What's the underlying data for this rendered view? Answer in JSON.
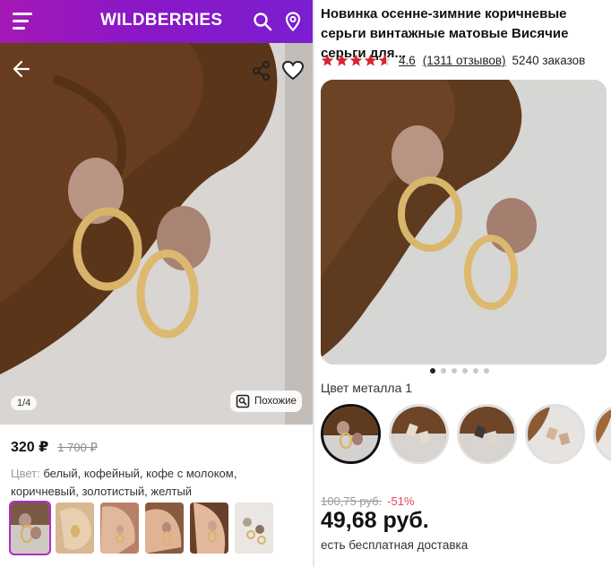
{
  "left": {
    "brand": "WILDBERRIES",
    "header_icons": [
      "menu-icon",
      "search-icon",
      "location-pin-icon"
    ],
    "overlay_icons": [
      "back-arrow-icon",
      "share-icon",
      "heart-icon"
    ],
    "image_counter": "1/4",
    "similar_label": "Похожие",
    "price": "320 ₽",
    "old_price": "1 700 ₽",
    "color_label": "Цвет:",
    "color_values": "белый, кофейный, кофе с молоком, коричневый, золотистый, желтый",
    "accent_color": "#a419b6"
  },
  "right": {
    "title": "Новинка осенне-зимние коричневые серьги винтажные матовые Висячие серьги для...",
    "rating": "4.6",
    "reviews": "(1311 отзывов)",
    "orders": "5240 заказов",
    "stars_value": 4.6,
    "slides_total": 6,
    "active_slide": 1,
    "metal_label": "Цвет металла 1",
    "old_price": "100,75 руб.",
    "discount": "-51%",
    "price": "49,68 руб.",
    "delivery": "есть бесплатная доставка",
    "star_color": "#d9232e",
    "discount_color": "#e8455a"
  }
}
